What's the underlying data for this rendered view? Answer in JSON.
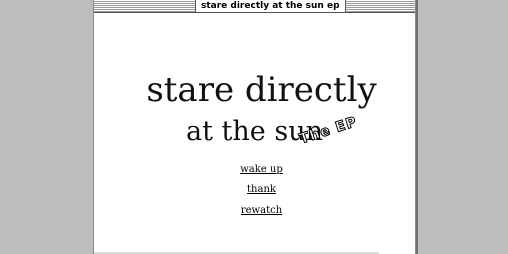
{
  "window": {
    "title": "stare directly at the sun ep"
  },
  "main": {
    "heading_line1": "stare directly",
    "heading_line2": "at the sun",
    "ep_tag": "The EP"
  },
  "links": [
    {
      "label": "wake up"
    },
    {
      "label": "thank"
    },
    {
      "label": "rewatch"
    }
  ]
}
